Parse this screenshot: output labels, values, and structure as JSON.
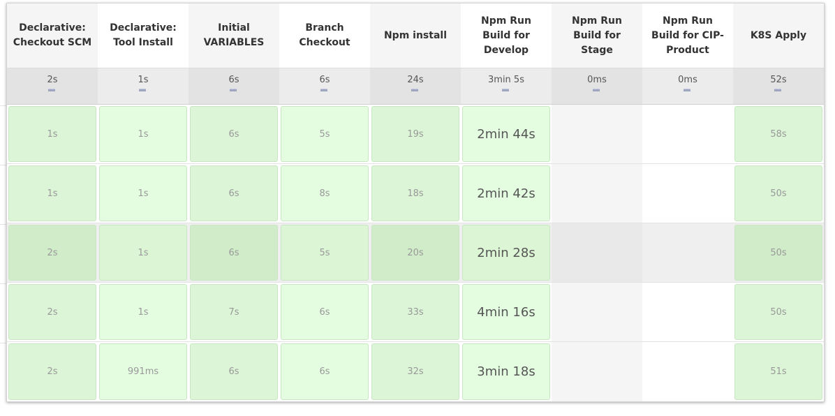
{
  "stages": [
    "Declarative: Checkout SCM",
    "Declarative: Tool Install",
    "Initial VARIABLES",
    "Branch Checkout",
    "Npm install",
    "Npm Run Build for Develop",
    "Npm Run Build for Stage",
    "Npm Run Build for CIP-Product",
    "K8S Apply"
  ],
  "averages": [
    "2s",
    "1s",
    "6s",
    "6s",
    "24s",
    "3min 5s",
    "0ms",
    "0ms",
    "52s"
  ],
  "builds": [
    [
      "1s",
      "1s",
      "6s",
      "5s",
      "19s",
      "2min 44s",
      "",
      "",
      "58s"
    ],
    [
      "1s",
      "1s",
      "6s",
      "8s",
      "18s",
      "2min 42s",
      "",
      "",
      "50s"
    ],
    [
      "2s",
      "1s",
      "6s",
      "5s",
      "20s",
      "2min 28s",
      "",
      "",
      "50s"
    ],
    [
      "2s",
      "1s",
      "7s",
      "6s",
      "33s",
      "4min 16s",
      "",
      "",
      "50s"
    ],
    [
      "2s",
      "991ms",
      "6s",
      "6s",
      "32s",
      "3min 18s",
      "",
      "",
      "51s"
    ]
  ],
  "colors": {
    "success_cell": "#dbf5d6",
    "success_cell_alt": "#e4fde1",
    "success_border": "#c9e5c4",
    "average_bar": "#9fa6c2"
  }
}
